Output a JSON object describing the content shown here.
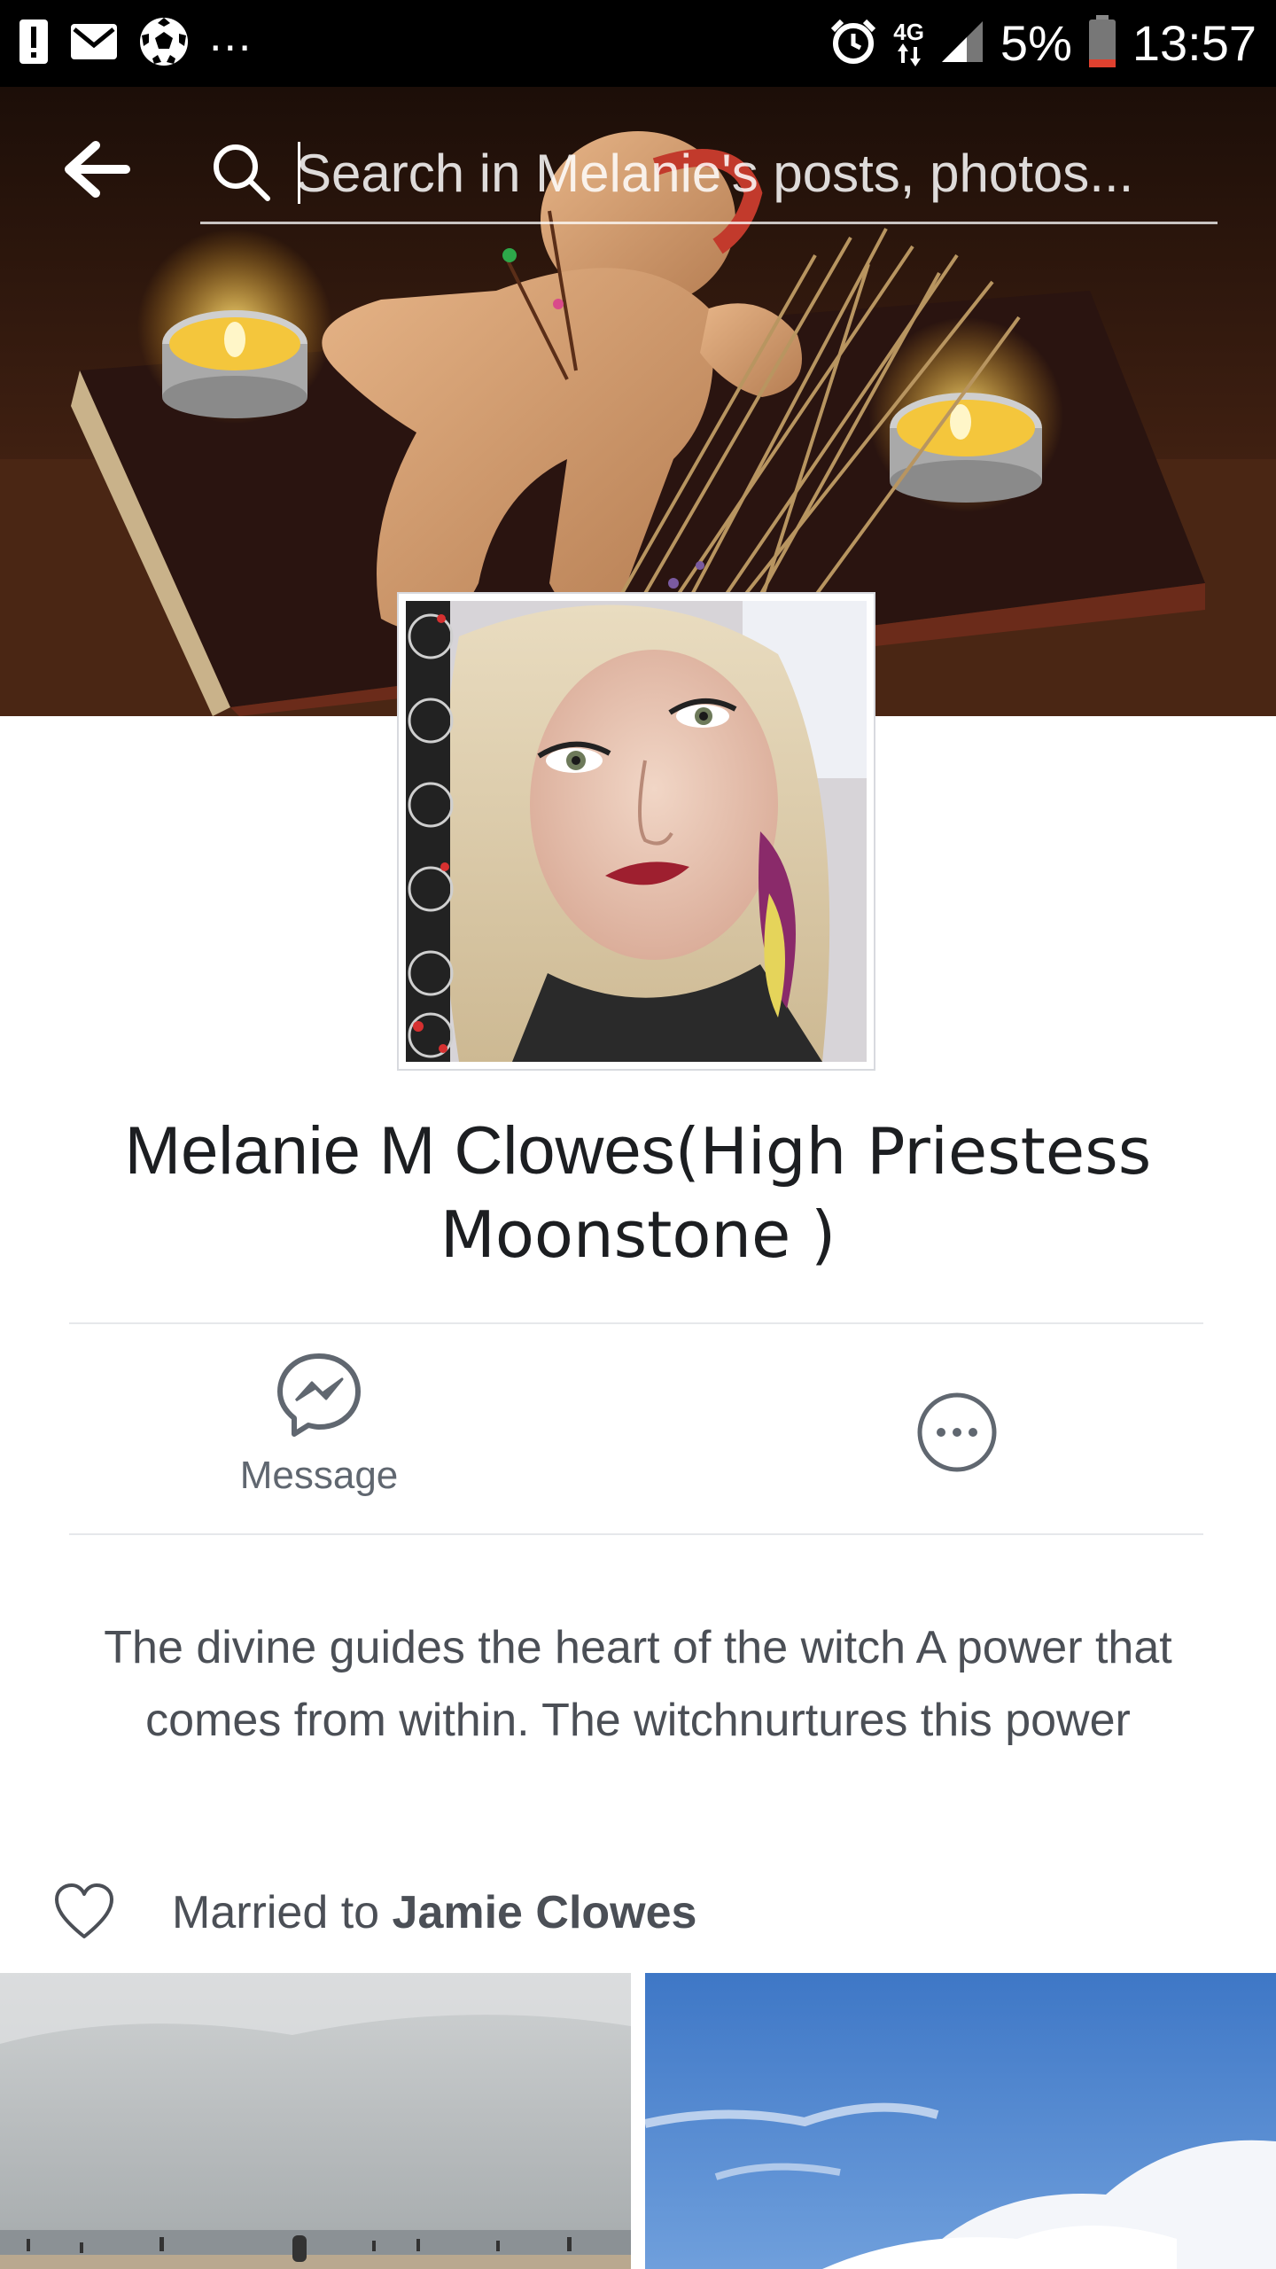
{
  "status_bar": {
    "time": "13:57",
    "battery": "5%",
    "network": "4G",
    "ellipsis": "...",
    "icons": [
      "alert-icon",
      "mail-icon",
      "soccer-ball-icon",
      "alarm-icon",
      "signal-icon",
      "battery-icon"
    ]
  },
  "search": {
    "placeholder": "Search in Melanie's posts, photos..."
  },
  "profile": {
    "name": "Melanie M Clowes",
    "alternate_name": "(High Priestess Moonstone )"
  },
  "actions": {
    "message_label": "Message"
  },
  "bio": "The divine guides the heart of the witch A power that comes from within. The witchnurtures this power",
  "relationship": {
    "prefix": "Married to ",
    "partner": "Jamie Clowes"
  },
  "colors": {
    "status_bar_bg": "#000000",
    "text_primary": "#1c1e21",
    "text_secondary": "#4b4f56",
    "icon_gray": "#606770",
    "divider": "#e6e8eb"
  }
}
